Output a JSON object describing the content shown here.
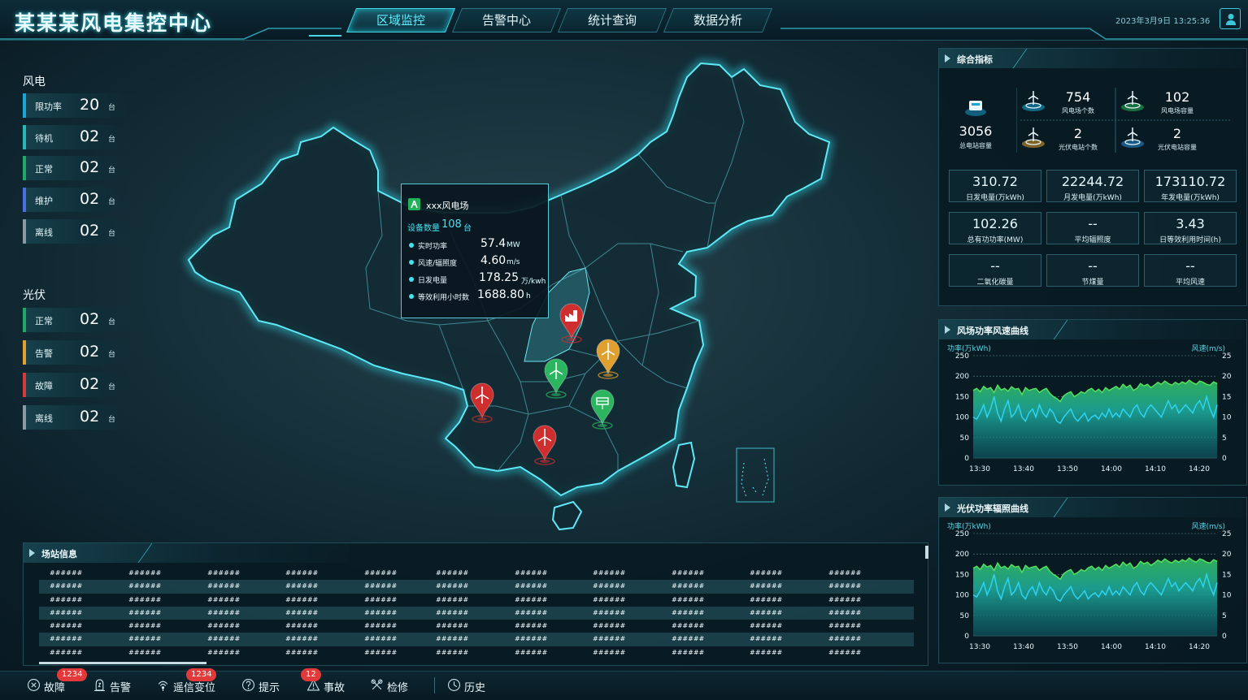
{
  "header": {
    "title": "某某某风电集控中心",
    "nav": [
      {
        "label": "区域监控",
        "active": true
      },
      {
        "label": "告警中心"
      },
      {
        "label": "统计查询"
      },
      {
        "label": "数据分析"
      }
    ],
    "datetime": "2023年3月9日 13:25:36"
  },
  "left": {
    "wind": {
      "label": "风电",
      "unit": "台",
      "items": [
        {
          "label": "限功率",
          "value": "20",
          "color": "#1aa5d8"
        },
        {
          "label": "待机",
          "value": "02",
          "color": "#2ab6b9"
        },
        {
          "label": "正常",
          "value": "02",
          "color": "#20a86a"
        },
        {
          "label": "维护",
          "value": "02",
          "color": "#4b6ee0"
        },
        {
          "label": "离线",
          "value": "02",
          "color": "#8a9aa2"
        }
      ]
    },
    "solar": {
      "label": "光伏",
      "unit": "台",
      "items": [
        {
          "label": "正常",
          "value": "02",
          "color": "#20a86a"
        },
        {
          "label": "告警",
          "value": "02",
          "color": "#e0a030"
        },
        {
          "label": "故障",
          "value": "02",
          "color": "#d63a3a"
        },
        {
          "label": "离线",
          "value": "02",
          "color": "#8a9aa2"
        }
      ]
    }
  },
  "tooltip": {
    "name": "xxx风电场",
    "device_label": "设备数量",
    "device_value": "108",
    "device_unit": "台",
    "rows": [
      {
        "label": "实时功率",
        "value": "57.4",
        "unit": "MW"
      },
      {
        "label": "风速/辐照度",
        "value": "4.60",
        "unit": "m/s"
      },
      {
        "label": "日发电量",
        "value": "178.25",
        "unit": "万/kwh"
      },
      {
        "label": "等效利用小时数",
        "value": "1688.80",
        "unit": "h"
      }
    ]
  },
  "markers": [
    {
      "type": "wind",
      "color": "#cf2e2e"
    },
    {
      "type": "plant",
      "color": "#cf2e2e"
    },
    {
      "type": "wind",
      "color": "#e0a030"
    },
    {
      "type": "wind",
      "color": "#2bb55f"
    },
    {
      "type": "solar",
      "color": "#2bb55f"
    },
    {
      "type": "wind",
      "color": "#cf2e2e"
    },
    {
      "type": "wind",
      "color": "#cf2e2e"
    }
  ],
  "overview": {
    "title": "综合指标",
    "total": {
      "value": "3056",
      "label": "总电站容量"
    },
    "items": [
      {
        "value": "754",
        "label": "风电场个数",
        "color": "#1aa5d8"
      },
      {
        "value": "102",
        "label": "风电场容量",
        "color": "#27b85a"
      },
      {
        "value": "2",
        "label": "光伏电站个数",
        "color": "#e0a030"
      },
      {
        "value": "2",
        "label": "光伏电站容量",
        "color": "#2a8fd8"
      }
    ],
    "boxes": [
      {
        "value": "310.72",
        "label": "日发电量(万kWh)"
      },
      {
        "value": "22244.72",
        "label": "月发电量(万kWh)"
      },
      {
        "value": "173110.72",
        "label": "年发电量(万kWh)"
      },
      {
        "value": "102.26",
        "label": "总有功功率(MW)"
      },
      {
        "value": "--",
        "label": "平均辐照度"
      },
      {
        "value": "3.43",
        "label": "日等效利用时间(h)"
      },
      {
        "value": "--",
        "label": "二氧化碳量"
      },
      {
        "value": "--",
        "label": "节煤量"
      },
      {
        "value": "--",
        "label": "平均风速"
      }
    ]
  },
  "charts": [
    {
      "title": "风场功率风速曲线",
      "ylabel_left": "功率(万kWh)",
      "ylabel_right": "风速(m/s)"
    },
    {
      "title": "光伏功率辐照曲线",
      "ylabel_left": "功率(万kWh)",
      "ylabel_right": "风速(m/s)"
    }
  ],
  "chart_data": [
    {
      "type": "area",
      "title": "风场功率风速曲线",
      "ylabel": "功率(万kWh)",
      "y2label": "风速(m/s)",
      "x": [
        "13:30",
        "13:40",
        "13:50",
        "14:00",
        "14:10",
        "14:20"
      ],
      "ylim": [
        0,
        250
      ],
      "y2lim": [
        0,
        25
      ],
      "grid": true,
      "series": [
        {
          "values": [
            165,
            170,
            162,
            175,
            168,
            172,
            160,
            178,
            166,
            170,
            163,
            174,
            168,
            170,
            155,
            172,
            165,
            168,
            170,
            160,
            166,
            170,
            158,
            150,
            145,
            138,
            152,
            158,
            162,
            150,
            155,
            162,
            158,
            166,
            170,
            162,
            168,
            160,
            172,
            165,
            170,
            175,
            168,
            180,
            172,
            178,
            165,
            170,
            182,
            176,
            180,
            172,
            178,
            185,
            180,
            188,
            182,
            178,
            185,
            180,
            186,
            182,
            190,
            184,
            180,
            188,
            185,
            180,
            178,
            186,
            182
          ]
        },
        {
          "values": [
            10,
            9.5,
            11,
            13,
            10,
            12,
            15,
            11,
            9,
            12,
            14,
            10,
            11,
            13,
            10,
            9,
            11,
            12,
            10,
            13,
            11,
            10,
            12,
            11,
            9,
            8.5,
            10,
            11,
            12,
            10,
            9,
            10,
            11,
            9,
            10,
            10.5,
            9.5,
            11,
            10,
            12,
            10,
            11,
            10,
            12,
            11,
            10,
            12,
            13,
            11,
            10,
            12,
            13,
            12,
            11,
            10,
            12,
            14,
            12,
            13,
            11,
            12,
            13,
            12,
            11,
            13,
            14,
            12,
            15,
            12,
            10,
            13
          ]
        }
      ]
    },
    {
      "type": "area",
      "title": "光伏功率辐照曲线",
      "ylabel": "功率(万kWh)",
      "y2label": "风速(m/s)",
      "x": [
        "13:30",
        "13:40",
        "13:50",
        "14:00",
        "14:10",
        "14:20"
      ],
      "ylim": [
        0,
        250
      ],
      "y2lim": [
        0,
        25
      ],
      "grid": true,
      "series": [
        {
          "values": [
            165,
            170,
            162,
            175,
            168,
            172,
            160,
            178,
            166,
            170,
            163,
            174,
            168,
            170,
            155,
            172,
            165,
            168,
            170,
            160,
            166,
            170,
            158,
            150,
            145,
            138,
            152,
            158,
            162,
            150,
            155,
            162,
            158,
            166,
            170,
            162,
            168,
            160,
            172,
            165,
            170,
            175,
            168,
            180,
            172,
            178,
            165,
            170,
            182,
            176,
            180,
            172,
            178,
            185,
            180,
            188,
            182,
            178,
            185,
            180,
            186,
            182,
            190,
            184,
            180,
            188,
            185,
            180,
            178,
            186,
            182
          ]
        },
        {
          "values": [
            10,
            9.5,
            11,
            13,
            10,
            12,
            15,
            11,
            9,
            12,
            14,
            10,
            11,
            13,
            10,
            9,
            11,
            12,
            10,
            13,
            11,
            10,
            12,
            11,
            9,
            8.5,
            10,
            11,
            12,
            10,
            9,
            10,
            11,
            9,
            10,
            10.5,
            9.5,
            11,
            10,
            12,
            10,
            11,
            10,
            12,
            11,
            10,
            12,
            13,
            11,
            10,
            12,
            13,
            12,
            11,
            10,
            12,
            14,
            12,
            13,
            11,
            12,
            13,
            12,
            11,
            13,
            14,
            12,
            15,
            12,
            10,
            13
          ]
        }
      ]
    }
  ],
  "station": {
    "title": "场站信息",
    "rows": [
      [
        "######",
        "######",
        "######",
        "######",
        "######",
        "######",
        "######",
        "######",
        "######",
        "######",
        "######"
      ],
      [
        "######",
        "######",
        "######",
        "######",
        "######",
        "######",
        "######",
        "######",
        "######",
        "######",
        "######"
      ],
      [
        "######",
        "######",
        "######",
        "######",
        "######",
        "######",
        "######",
        "######",
        "######",
        "######",
        "######"
      ],
      [
        "######",
        "######",
        "######",
        "######",
        "######",
        "######",
        "######",
        "######",
        "######",
        "######",
        "######"
      ],
      [
        "######",
        "######",
        "######",
        "######",
        "######",
        "######",
        "######",
        "######",
        "######",
        "######",
        "######"
      ],
      [
        "######",
        "######",
        "######",
        "######",
        "######",
        "######",
        "######",
        "######",
        "######",
        "######",
        "######"
      ],
      [
        "######",
        "######",
        "######",
        "######",
        "######",
        "######",
        "######",
        "######",
        "######",
        "######",
        "######"
      ]
    ]
  },
  "footer": {
    "items": [
      {
        "label": "故障",
        "badge": "1234"
      },
      {
        "label": "告警"
      },
      {
        "label": "遥信变位",
        "badge": "1234"
      },
      {
        "label": "提示"
      },
      {
        "label": "事故",
        "badge": "12"
      },
      {
        "label": "检修"
      },
      {
        "label": "历史"
      }
    ]
  }
}
